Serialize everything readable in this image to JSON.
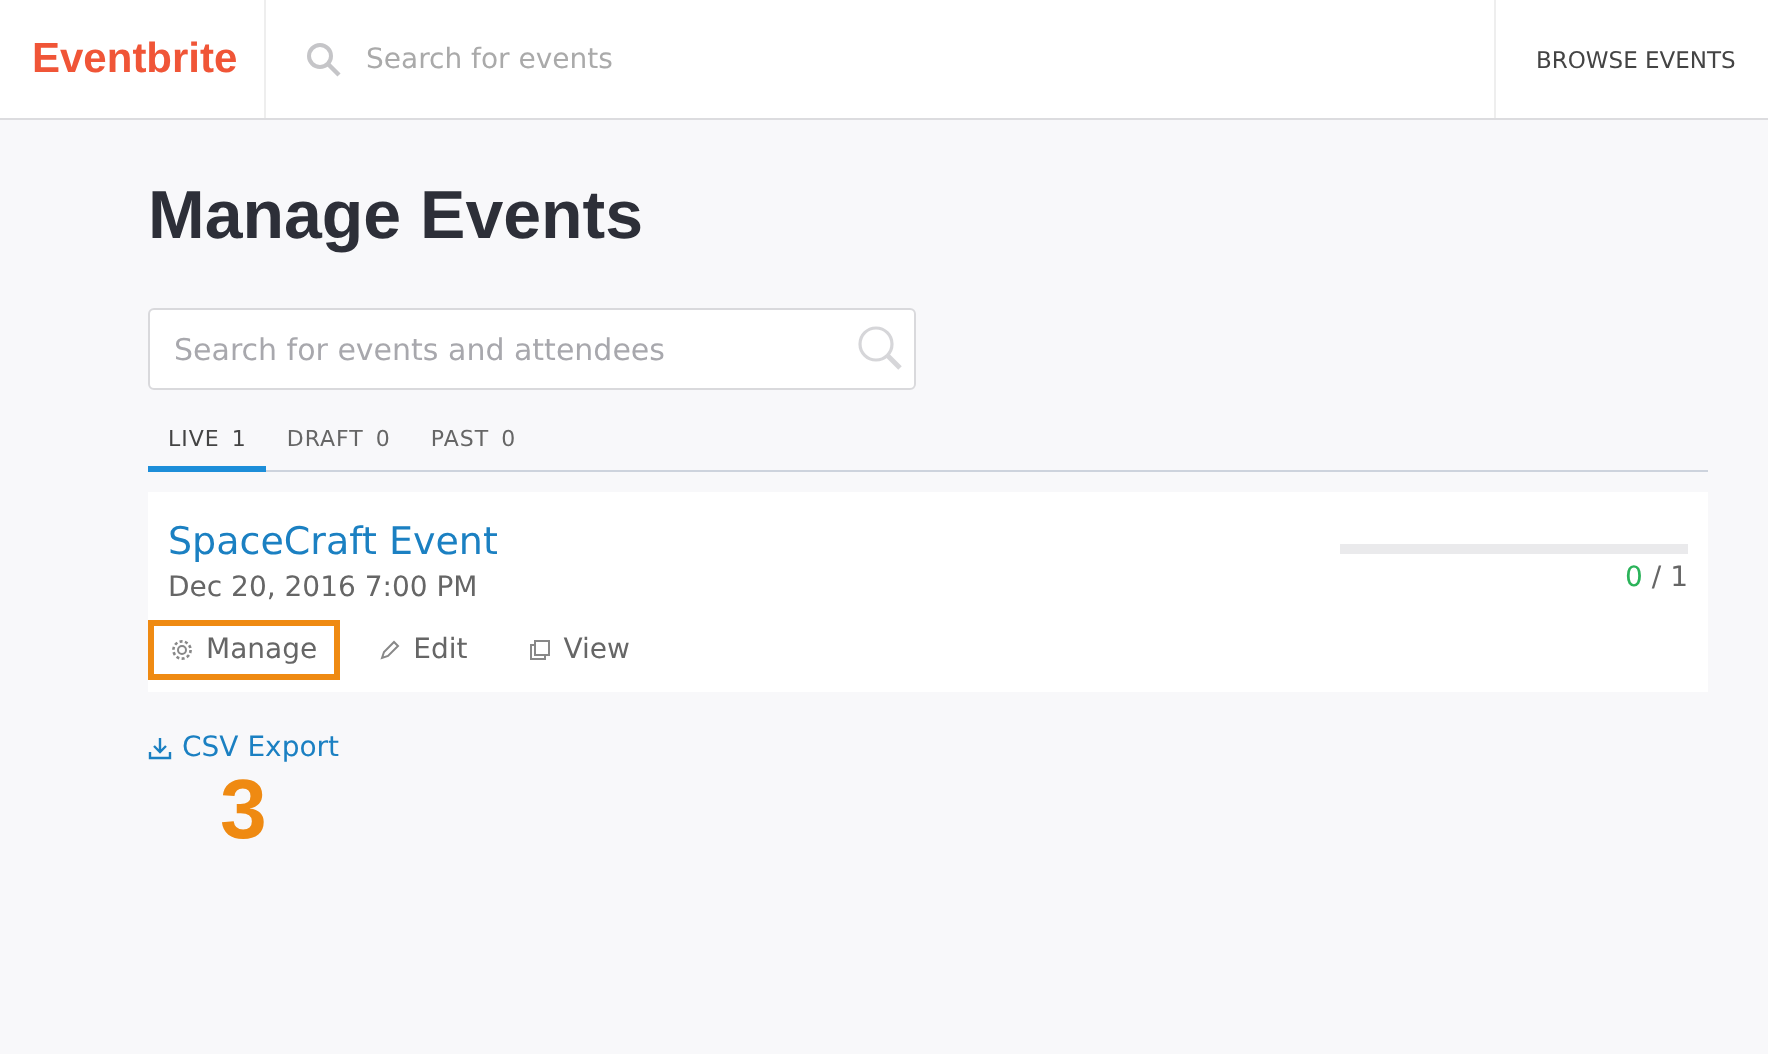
{
  "header": {
    "logo": "Eventbrite",
    "search": {
      "placeholder": "Search for events"
    },
    "nav": "BROWSE EVENTS"
  },
  "title": "Manage Events",
  "search": {
    "placeholder": "Search for events and attendees"
  },
  "tabs": [
    {
      "label": "LIVE",
      "count": "1",
      "selected": true
    },
    {
      "label": "DRAFT",
      "count": "0",
      "selected": false
    },
    {
      "label": "PAST",
      "count": "0",
      "selected": false
    }
  ],
  "events": [
    {
      "name": "SpaceCraft Event",
      "date": "Dec 20, 2016 7:00 PM",
      "sold": "0",
      "capacity": "/ 1",
      "level": 0,
      "actions": [
        {
          "kind": "gear",
          "label": "Manage",
          "highlighted": true
        },
        {
          "kind": "pencil",
          "label": "Edit",
          "highlighted": false
        },
        {
          "kind": "view",
          "label": "View",
          "highlighted": false
        }
      ]
    }
  ],
  "export": "CSV Export",
  "step": "3"
}
